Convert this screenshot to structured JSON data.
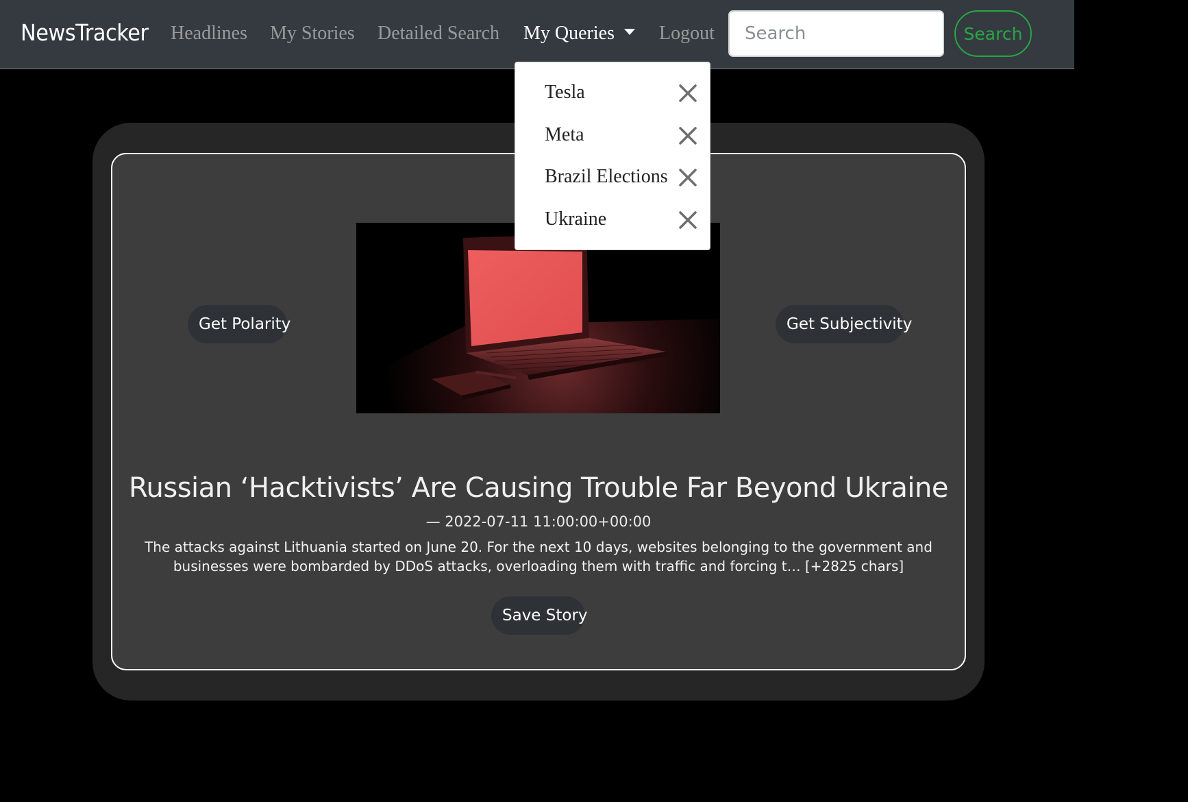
{
  "navbar": {
    "brand": "NewsTracker",
    "links": [
      {
        "label": "Headlines"
      },
      {
        "label": "My Stories"
      },
      {
        "label": "Detailed Search"
      },
      {
        "label": "My Queries"
      },
      {
        "label": "Logout"
      }
    ],
    "search_placeholder": "Search",
    "search_value": "",
    "search_button": "Search"
  },
  "queries_dropdown": {
    "items": [
      {
        "label": "Tesla",
        "icon": "close-icon"
      },
      {
        "label": "Meta",
        "icon": "close-icon"
      },
      {
        "label": "Brazil Elections",
        "icon": "close-icon"
      },
      {
        "label": "Ukraine",
        "icon": "close-icon"
      }
    ]
  },
  "story": {
    "polarity_button": "Get Polarity",
    "subjectivity_button": "Get Subjectivity",
    "title": "Russian ‘Hacktivists’ Are Causing Trouble Far Beyond Ukraine",
    "date": "— 2022-07-11 11:00:00+00:00",
    "description": "The attacks against Lithuania started on June 20. For the next 10 days, websites belonging to the government and businesses were bombarded by DDoS attacks, overloading them with traffic and forcing t… [+2825 chars]",
    "save_button": "Save Story",
    "image": "laptop-red-screen-image"
  },
  "colors": {
    "navbar_bg": "#343a40",
    "accent_green": "#28a745",
    "card_bg": "#3d3d3d",
    "outer_bg": "#262626"
  }
}
